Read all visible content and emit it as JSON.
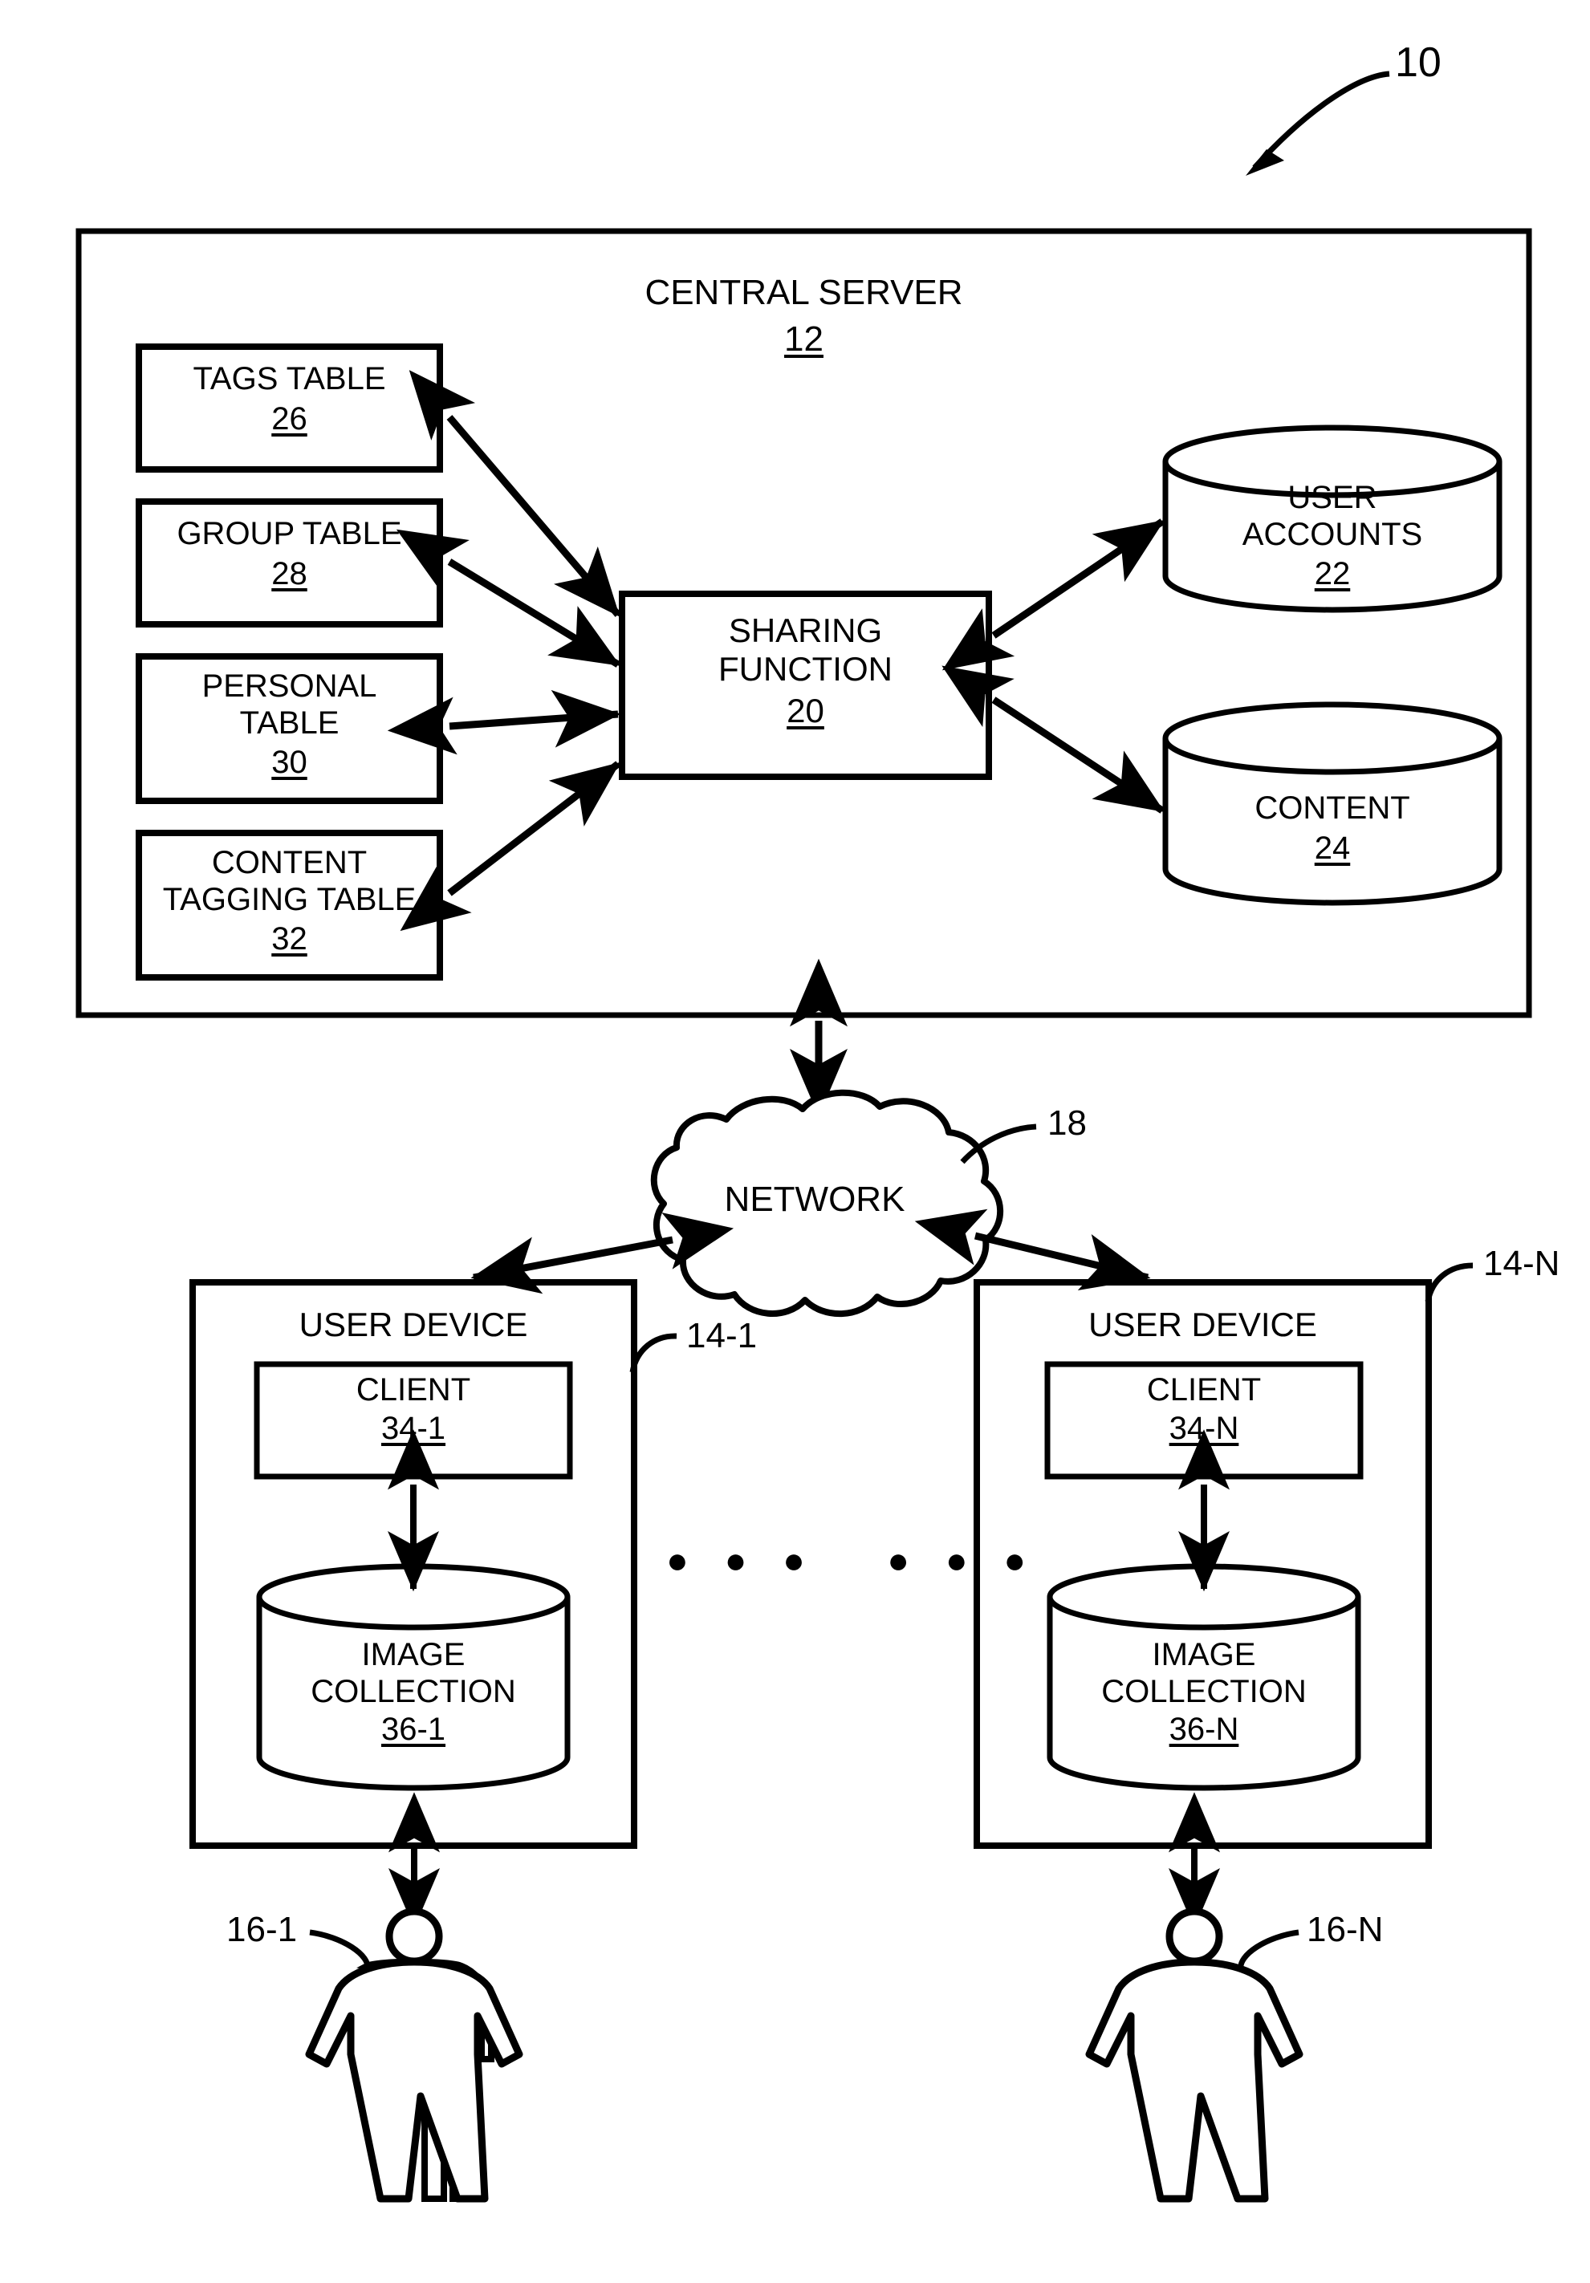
{
  "figure": {
    "reference_label": "10",
    "server": {
      "title": "CENTRAL SERVER",
      "ref": "12"
    },
    "tables": [
      {
        "name": "tags-table",
        "line1": "TAGS TABLE",
        "line2": "",
        "ref": "26"
      },
      {
        "name": "group-table",
        "line1": "GROUP TABLE",
        "line2": "",
        "ref": "28"
      },
      {
        "name": "personal-table",
        "line1": "PERSONAL",
        "line2": "TABLE",
        "ref": "30"
      },
      {
        "name": "content-tagging-table",
        "line1": "CONTENT",
        "line2": "TAGGING TABLE",
        "ref": "32"
      }
    ],
    "sharing_function": {
      "line1": "SHARING",
      "line2": "FUNCTION",
      "ref": "20"
    },
    "stores": [
      {
        "name": "user-accounts-store",
        "line1": "USER",
        "line2": "ACCOUNTS",
        "ref": "22"
      },
      {
        "name": "content-store",
        "line1": "CONTENT",
        "line2": "",
        "ref": "24"
      }
    ],
    "network": {
      "label": "NETWORK",
      "ref": "18"
    },
    "user_devices": [
      {
        "name": "user-device-1",
        "title": "USER DEVICE",
        "device_ref": "14-1",
        "client": {
          "label": "CLIENT",
          "ref": "34-1"
        },
        "image_collection": {
          "line1": "IMAGE",
          "line2": "COLLECTION",
          "ref": "36-1"
        },
        "user_ref": "16-1"
      },
      {
        "name": "user-device-n",
        "title": "USER DEVICE",
        "device_ref": "14-N",
        "client": {
          "label": "CLIENT",
          "ref": "34-N"
        },
        "image_collection": {
          "line1": "IMAGE",
          "line2": "COLLECTION",
          "ref": "36-N"
        },
        "user_ref": "16-N"
      }
    ],
    "ellipsis": "● ● ●   ● ● ●",
    "colors": {
      "ink": "#000000",
      "paper": "#ffffff"
    }
  }
}
